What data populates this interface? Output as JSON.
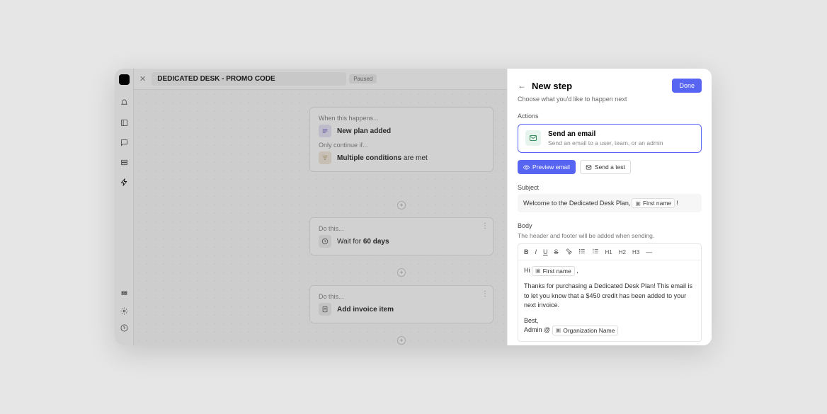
{
  "topbar": {
    "title": "DEDICATED DESK - PROMO CODE",
    "status": "Paused"
  },
  "rail": {
    "items": [
      "bell",
      "layout",
      "chat",
      "cards",
      "bolt"
    ],
    "bottom": [
      "grid",
      "gear",
      "help"
    ]
  },
  "flow": {
    "card1": {
      "trigger_label": "When this happens...",
      "trigger_text": "New plan added",
      "cond_label": "Only continue if...",
      "cond_bold": "Multiple conditions",
      "cond_rest": " are met"
    },
    "card2": {
      "label": "Do this...",
      "pre": "Wait for ",
      "bold": "60 days"
    },
    "card3": {
      "label": "Do this...",
      "text": "Add invoice item"
    }
  },
  "panel": {
    "title": "New step",
    "subtitle": "Choose what you'd like to happen next",
    "done": "Done",
    "actions_label": "Actions",
    "action": {
      "title": "Send an email",
      "desc": "Send an email to a user, team, or an admin"
    },
    "preview_btn": "Preview email",
    "test_btn": "Send a test",
    "subject_label": "Subject",
    "subject_text": "Welcome to the Dedicated Desk Plan, ",
    "subject_token": "First name",
    "subject_tail": "!",
    "body_label": "Body",
    "body_note": "The header and footer will be added when sending.",
    "body": {
      "greeting_pre": "Hi ",
      "greeting_token": "First name",
      "greeting_post": ",",
      "para": "Thanks for purchasing a Dedicated Desk Plan! This email is to let you know that a $450 credit has been added to your next invoice.",
      "sign1": "Best,",
      "sign2_pre": "Admin @ ",
      "sign2_token": "Organization Name"
    }
  }
}
